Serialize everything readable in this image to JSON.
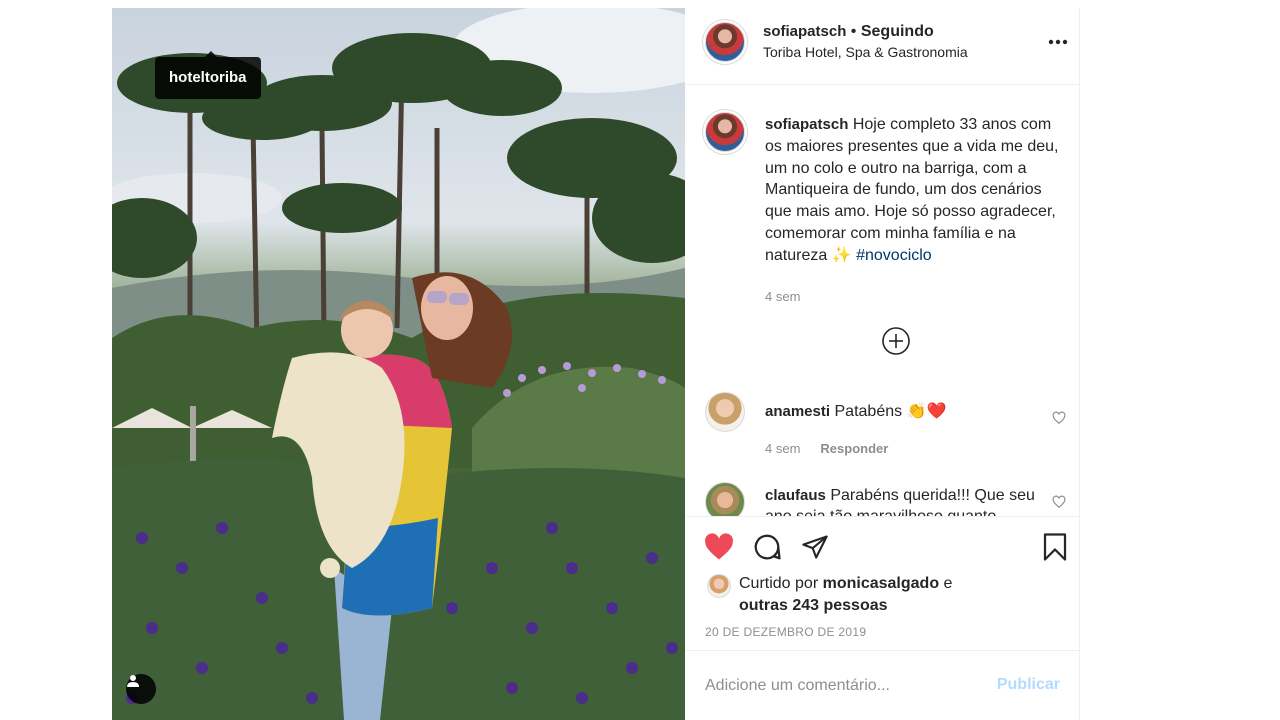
{
  "photo": {
    "tag_label": "hoteltoriba",
    "alt": ""
  },
  "header": {
    "username": "sofiapatsch",
    "separator": " • ",
    "follow_status": "Seguindo",
    "location": "Toriba Hotel, Spa & Gastronomia",
    "more_icon": "more-horizontal-icon"
  },
  "caption": {
    "username": "sofiapatsch",
    "text": "Hoje completo 33 anos com os maiores presentes que a vida me deu, um no colo e outro na barriga, com a Mantiqueira de fundo, um dos cenários que mais amo. Hoje só posso agradecer, comemorar com minha família e na natureza",
    "emoji": "✨",
    "hashtag": "#novociclo",
    "time": "4 sem"
  },
  "comments": [
    {
      "username": "anamesti",
      "text": "Patabéns",
      "emoji": "👏❤️",
      "time": "4 sem",
      "reply_label": "Responder"
    },
    {
      "username": "claufaus",
      "text": "Parabéns querida!!! Que seu ano seja tão maravilhoso quanto"
    }
  ],
  "actions": {
    "like_icon": "heart-filled-icon",
    "comment_icon": "comment-icon",
    "share_icon": "paper-plane-icon",
    "save_icon": "bookmark-icon",
    "liked_prefix": "Curtido por",
    "liked_user": "monicasalgado",
    "liked_connector": " e",
    "liked_others": "outras 243 pessoas",
    "date": "20 DE DEZEMBRO DE 2019"
  },
  "add_comment": {
    "placeholder": "Adicione um comentário...",
    "publish_label": "Publicar"
  },
  "colors": {
    "like_red": "#ed4956",
    "link_blue": "#00376b",
    "publish_disabled": "#b3dbff",
    "muted": "#8e8e8e"
  }
}
